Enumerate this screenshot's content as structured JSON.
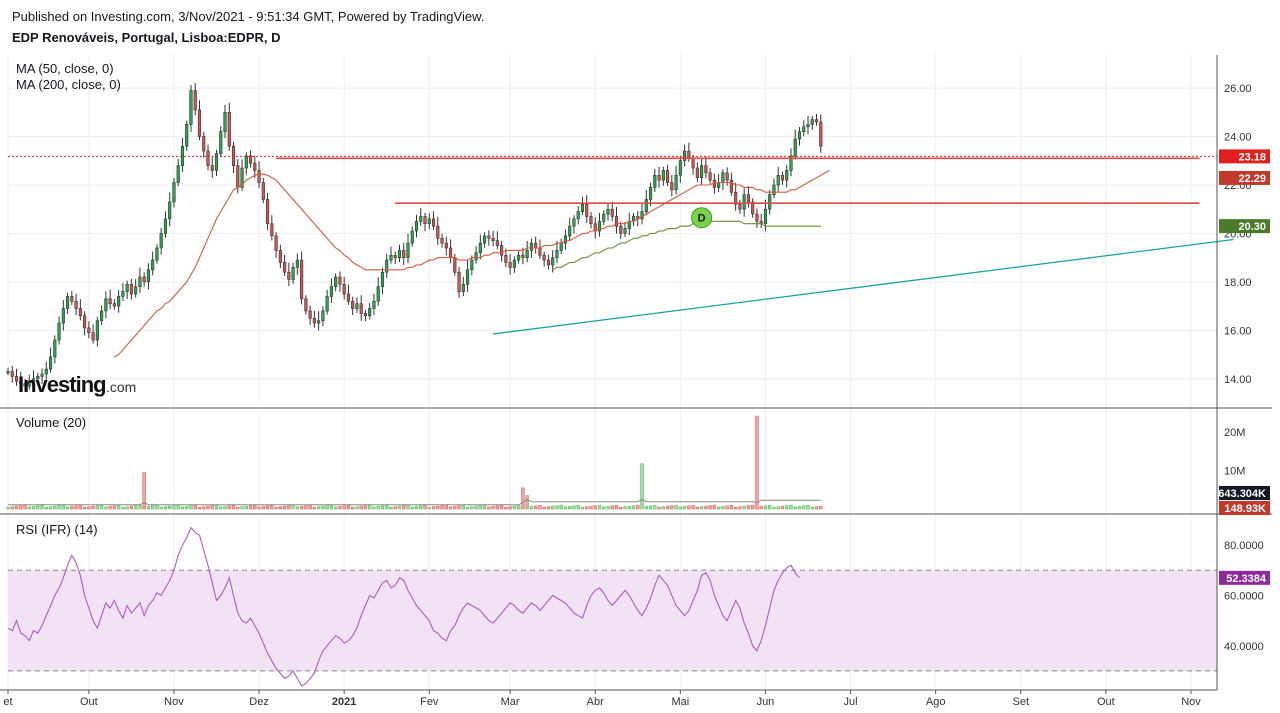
{
  "header": {
    "published": "Published on Investing.com, 3/Nov/2021 - 9:51:34 GMT, Powered by TradingView.",
    "symbol": "EDP Renováveis, Portugal, Lisboa:EDPR, D"
  },
  "logo": {
    "brand": "Investing",
    "suffix": ".com"
  },
  "colors": {
    "up": "#26a94c",
    "down": "#d9534f",
    "ma50": "#d25a3c",
    "ma200": "#6b8e3a",
    "trend": "#1aa39a",
    "resistance": "#e04848",
    "rsi": "#b05cc4",
    "rsi_band": "#f1e3f4"
  },
  "chart_data": [
    {
      "type": "candlestick",
      "title": "EDP Renováveis, Portugal, Lisboa:EDPR, D",
      "legend": [
        "MA (50, close, 0)",
        "MA (200, close, 0)"
      ],
      "x_ticks": [
        "et",
        "Out",
        "Nov",
        "Dez",
        "2021",
        "Fev",
        "Mar",
        "Abr",
        "Mai",
        "Jun",
        "Jul",
        "Ago",
        "Set",
        "Out",
        "Nov"
      ],
      "x_tick_index": [
        0,
        19,
        39,
        59,
        79,
        99,
        118,
        138,
        158,
        178,
        198,
        218,
        238,
        258,
        278
      ],
      "y_ticks": [
        "14.00",
        "16.00",
        "18.00",
        "20.00",
        "22.00",
        "24.00",
        "26.00"
      ],
      "ylim": [
        13.0,
        27.2
      ],
      "close": [
        14.3,
        14.1,
        13.9,
        13.8,
        13.7,
        13.9,
        14.0,
        14.1,
        14.2,
        14.4,
        14.9,
        15.6,
        16.3,
        16.9,
        17.4,
        17.2,
        16.9,
        16.6,
        16.1,
        15.9,
        15.6,
        16.4,
        16.8,
        17.3,
        17.1,
        17.0,
        17.4,
        17.6,
        17.9,
        17.5,
        17.8,
        18.2,
        18.0,
        18.5,
        18.9,
        19.4,
        20.0,
        20.6,
        21.3,
        22.1,
        22.8,
        23.6,
        24.5,
        25.9,
        25.1,
        24.0,
        23.4,
        22.8,
        22.6,
        23.3,
        24.2,
        25.0,
        23.6,
        22.8,
        21.9,
        22.7,
        23.2,
        22.9,
        22.6,
        22.1,
        21.4,
        20.4,
        19.9,
        19.3,
        18.8,
        18.4,
        18.1,
        18.6,
        18.9,
        17.3,
        16.8,
        16.5,
        16.3,
        16.4,
        16.8,
        17.4,
        17.8,
        18.2,
        17.9,
        17.5,
        17.2,
        16.9,
        17.1,
        16.7,
        16.6,
        16.9,
        17.2,
        17.8,
        18.4,
        18.9,
        19.1,
        19.0,
        19.3,
        19.0,
        19.6,
        20.1,
        20.5,
        20.7,
        20.4,
        20.6,
        20.3,
        19.8,
        19.6,
        19.4,
        19.0,
        18.4,
        17.6,
        17.9,
        18.5,
        18.9,
        19.2,
        19.6,
        19.9,
        19.8,
        19.7,
        19.5,
        19.1,
        18.8,
        18.6,
        18.9,
        19.1,
        19.0,
        19.3,
        19.6,
        19.4,
        19.1,
        18.9,
        18.7,
        19.0,
        19.3,
        19.6,
        19.9,
        20.3,
        20.6,
        20.9,
        21.2,
        20.7,
        20.4,
        20.1,
        20.5,
        20.8,
        21.0,
        20.7,
        20.3,
        20.0,
        20.2,
        20.5,
        20.7,
        20.6,
        20.9,
        21.4,
        21.9,
        22.4,
        22.2,
        22.6,
        22.1,
        21.8,
        22.4,
        23.0,
        23.4,
        23.1,
        22.7,
        22.3,
        22.8,
        22.5,
        22.2,
        21.9,
        22.1,
        22.5,
        22.2,
        21.7,
        21.2,
        21.0,
        21.6,
        21.3,
        20.8,
        20.5,
        20.4,
        21.0,
        21.6,
        22.0,
        22.4,
        22.2,
        22.6,
        23.2,
        23.9,
        24.2,
        24.4,
        24.5,
        24.7,
        24.6,
        23.6
      ],
      "ma50": [
        null,
        null,
        null,
        null,
        null,
        null,
        null,
        null,
        null,
        null,
        null,
        null,
        null,
        null,
        null,
        null,
        null,
        null,
        null,
        null,
        null,
        null,
        null,
        null,
        null,
        14.9,
        15.0,
        15.2,
        15.4,
        15.6,
        15.8,
        16.0,
        16.2,
        16.4,
        16.6,
        16.8,
        16.9,
        17.1,
        17.2,
        17.4,
        17.6,
        17.8,
        18.0,
        18.3,
        18.6,
        19.0,
        19.4,
        19.8,
        20.2,
        20.6,
        20.9,
        21.2,
        21.5,
        21.8,
        21.9,
        22.0,
        22.2,
        22.3,
        22.4,
        22.45,
        22.45,
        22.4,
        22.3,
        22.2,
        22.0,
        21.8,
        21.6,
        21.4,
        21.2,
        21.0,
        20.8,
        20.6,
        20.4,
        20.2,
        20.0,
        19.8,
        19.6,
        19.4,
        19.3,
        19.1,
        19.0,
        18.8,
        18.7,
        18.6,
        18.5,
        18.5,
        18.5,
        18.5,
        18.5,
        18.5,
        18.5,
        18.5,
        18.5,
        18.5,
        18.6,
        18.6,
        18.7,
        18.7,
        18.8,
        18.9,
        18.9,
        19.0,
        19.0,
        19.0,
        19.0,
        19.0,
        18.9,
        18.9,
        18.9,
        19.0,
        19.0,
        19.0,
        19.1,
        19.1,
        19.2,
        19.2,
        19.2,
        19.3,
        19.3,
        19.3,
        19.3,
        19.3,
        19.4,
        19.4,
        19.4,
        19.4,
        19.5,
        19.5,
        19.5,
        19.6,
        19.6,
        19.7,
        19.7,
        19.8,
        19.9,
        20.0,
        20.0,
        20.1,
        20.1,
        20.2,
        20.2,
        20.3,
        20.3,
        20.4,
        20.4,
        20.4,
        20.5,
        20.5,
        20.6,
        20.7,
        20.8,
        20.9,
        21.0,
        21.1,
        21.2,
        21.3,
        21.4,
        21.5,
        21.6,
        21.7,
        21.8,
        21.9,
        22.0,
        22.0,
        22.0,
        22.0,
        22.1,
        22.1,
        22.1,
        22.1,
        22.1,
        22.0,
        22.0,
        21.9,
        21.9,
        21.9,
        21.8,
        21.8,
        21.7,
        21.7,
        21.7,
        21.7,
        21.7,
        21.7,
        21.8,
        21.8,
        21.9,
        22.0,
        22.1,
        22.2,
        22.3,
        22.4,
        22.5,
        22.6
      ],
      "ma200": [
        null,
        null,
        null,
        null,
        null,
        null,
        null,
        null,
        null,
        null,
        null,
        null,
        null,
        null,
        null,
        null,
        null,
        null,
        null,
        null,
        null,
        null,
        null,
        null,
        null,
        null,
        null,
        null,
        null,
        null,
        null,
        null,
        null,
        null,
        null,
        null,
        null,
        null,
        null,
        null,
        null,
        null,
        null,
        null,
        null,
        null,
        null,
        null,
        null,
        null,
        null,
        null,
        null,
        null,
        null,
        null,
        null,
        null,
        null,
        null,
        null,
        null,
        null,
        null,
        null,
        null,
        null,
        null,
        null,
        null,
        null,
        null,
        null,
        null,
        null,
        null,
        null,
        null,
        null,
        null,
        null,
        null,
        null,
        null,
        null,
        null,
        null,
        null,
        null,
        null,
        null,
        null,
        null,
        null,
        null,
        null,
        null,
        null,
        null,
        null,
        null,
        null,
        null,
        null,
        null,
        null,
        null,
        null,
        null,
        null,
        null,
        null,
        null,
        null,
        null,
        null,
        null,
        null,
        null,
        null,
        null,
        null,
        null,
        null,
        null,
        null,
        null,
        null,
        18.5,
        18.6,
        18.6,
        18.7,
        18.8,
        18.8,
        18.9,
        19.0,
        19.0,
        19.1,
        19.2,
        19.2,
        19.3,
        19.4,
        19.4,
        19.5,
        19.6,
        19.6,
        19.7,
        19.8,
        19.8,
        19.9,
        19.9,
        20.0,
        20.0,
        20.1,
        20.1,
        20.2,
        20.2,
        20.2,
        20.3,
        20.3,
        20.3,
        20.4,
        20.4,
        20.4,
        20.4,
        20.5,
        20.5,
        20.5,
        20.5,
        20.5,
        20.5,
        20.5,
        20.5,
        20.4,
        20.4,
        20.4,
        20.4,
        20.4,
        20.3,
        20.3,
        20.3,
        20.3,
        20.3,
        20.3,
        20.3,
        20.3,
        20.3,
        20.3,
        20.3,
        20.3,
        20.3,
        20.3
      ],
      "trendline": [
        [
          114,
          15.85
        ],
        [
          288,
          19.75
        ]
      ],
      "resistance_lines": [
        [
          [
            63,
            23.1
          ],
          [
            280,
            23.1
          ]
        ],
        [
          [
            91,
            21.25
          ],
          [
            280,
            21.25
          ]
        ]
      ],
      "horizontal_line": 23.18,
      "marker": {
        "index": 163,
        "price": 20.4,
        "label": "D"
      },
      "price_tags": [
        {
          "value": 23.18,
          "label": "23.18",
          "color": "#e02020"
        },
        {
          "value": 22.29,
          "label": "22.29",
          "color": "#c0392b"
        },
        {
          "value": 20.3,
          "label": "20.30",
          "color": "#4a7a2a"
        }
      ]
    },
    {
      "type": "bar",
      "title": "Volume (20)",
      "y_ticks": [
        "10M",
        "20M"
      ],
      "ylim": [
        0,
        25
      ],
      "spikes": [
        {
          "index": 32,
          "value": 9.5,
          "color": "up-down:down"
        },
        {
          "index": 121,
          "value": 5.5,
          "color": "up-down:down"
        },
        {
          "index": 122,
          "value": 3.5,
          "color": "up-down:down"
        },
        {
          "index": 149,
          "value": 11.8,
          "color": "up-down:up"
        },
        {
          "index": 176,
          "value": 24.2,
          "color": "up-down:down"
        },
        {
          "index": 240,
          "value": 1.8,
          "color": "up-down:up"
        }
      ],
      "baseline_volume": 0.8,
      "avg_volume": 1.1,
      "price_tags": [
        {
          "label": "643.304K",
          "color": "#131722"
        },
        {
          "label": "148.93K",
          "color": "#c0392b"
        }
      ]
    },
    {
      "type": "line",
      "title": "RSI (IFR) (14)",
      "y_ticks": [
        "40.0000",
        "60.0000",
        "80.0000"
      ],
      "ylim": [
        24,
        90
      ],
      "bands": [
        30,
        70
      ],
      "values": [
        47,
        46,
        50,
        45,
        44,
        42,
        46,
        45,
        48,
        52,
        56,
        60,
        63,
        67,
        72,
        76,
        73,
        68,
        60,
        55,
        50,
        47,
        52,
        57,
        55,
        58,
        54,
        51,
        56,
        53,
        55,
        57,
        52,
        56,
        58,
        61,
        60,
        63,
        66,
        70,
        76,
        80,
        83,
        87,
        85,
        84,
        78,
        72,
        65,
        58,
        60,
        63,
        67,
        60,
        53,
        50,
        49,
        51,
        48,
        45,
        41,
        37,
        34,
        31,
        29,
        27,
        28,
        30,
        27,
        24,
        25,
        27,
        29,
        34,
        38,
        40,
        42,
        44,
        43,
        41,
        42,
        44,
        47,
        52,
        56,
        60,
        59,
        62,
        65,
        66,
        63,
        64,
        67,
        66,
        62,
        59,
        56,
        54,
        52,
        50,
        46,
        45,
        43,
        42,
        46,
        48,
        52,
        55,
        57,
        56,
        55,
        54,
        52,
        50,
        49,
        51,
        53,
        55,
        57,
        56,
        54,
        53,
        55,
        57,
        56,
        54,
        56,
        58,
        60,
        59,
        58,
        57,
        55,
        53,
        52,
        51,
        56,
        60,
        62,
        63,
        61,
        58,
        56,
        58,
        60,
        62,
        60,
        57,
        54,
        52,
        55,
        59,
        64,
        68,
        66,
        64,
        60,
        56,
        54,
        52,
        54,
        58,
        62,
        68,
        69,
        66,
        60,
        56,
        52,
        50,
        54,
        58,
        55,
        49,
        45,
        40,
        38,
        42,
        48,
        55,
        62,
        66,
        69,
        71,
        72,
        69,
        67
      ],
      "last_value_tag": "52.3384"
    }
  ]
}
